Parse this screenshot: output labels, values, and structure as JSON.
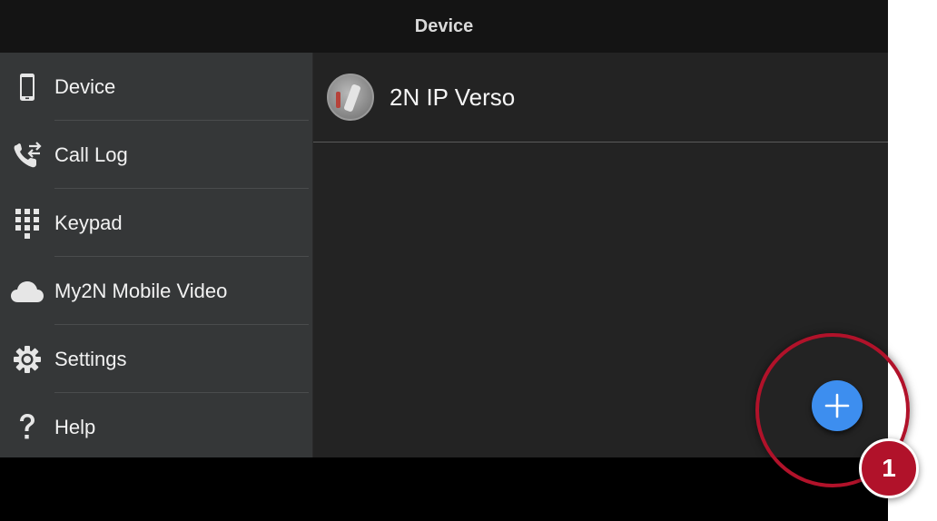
{
  "appbar": {
    "title": "Device"
  },
  "sidebar": {
    "items": [
      {
        "label": "Device",
        "icon": "smartphone-icon"
      },
      {
        "label": "Call Log",
        "icon": "call-log-icon"
      },
      {
        "label": "Keypad",
        "icon": "dialpad-icon"
      },
      {
        "label": "My2N Mobile Video",
        "icon": "cloud-icon"
      },
      {
        "label": "Settings",
        "icon": "gear-icon"
      },
      {
        "label": "Help",
        "icon": "question-icon"
      }
    ]
  },
  "main": {
    "devices": [
      {
        "name": "2N IP Verso",
        "avatar": "intercom-device-avatar"
      }
    ]
  },
  "fab": {
    "icon": "plus-icon",
    "color": "#3d8eef"
  },
  "callout": {
    "number": "1",
    "color": "#b1122a"
  }
}
